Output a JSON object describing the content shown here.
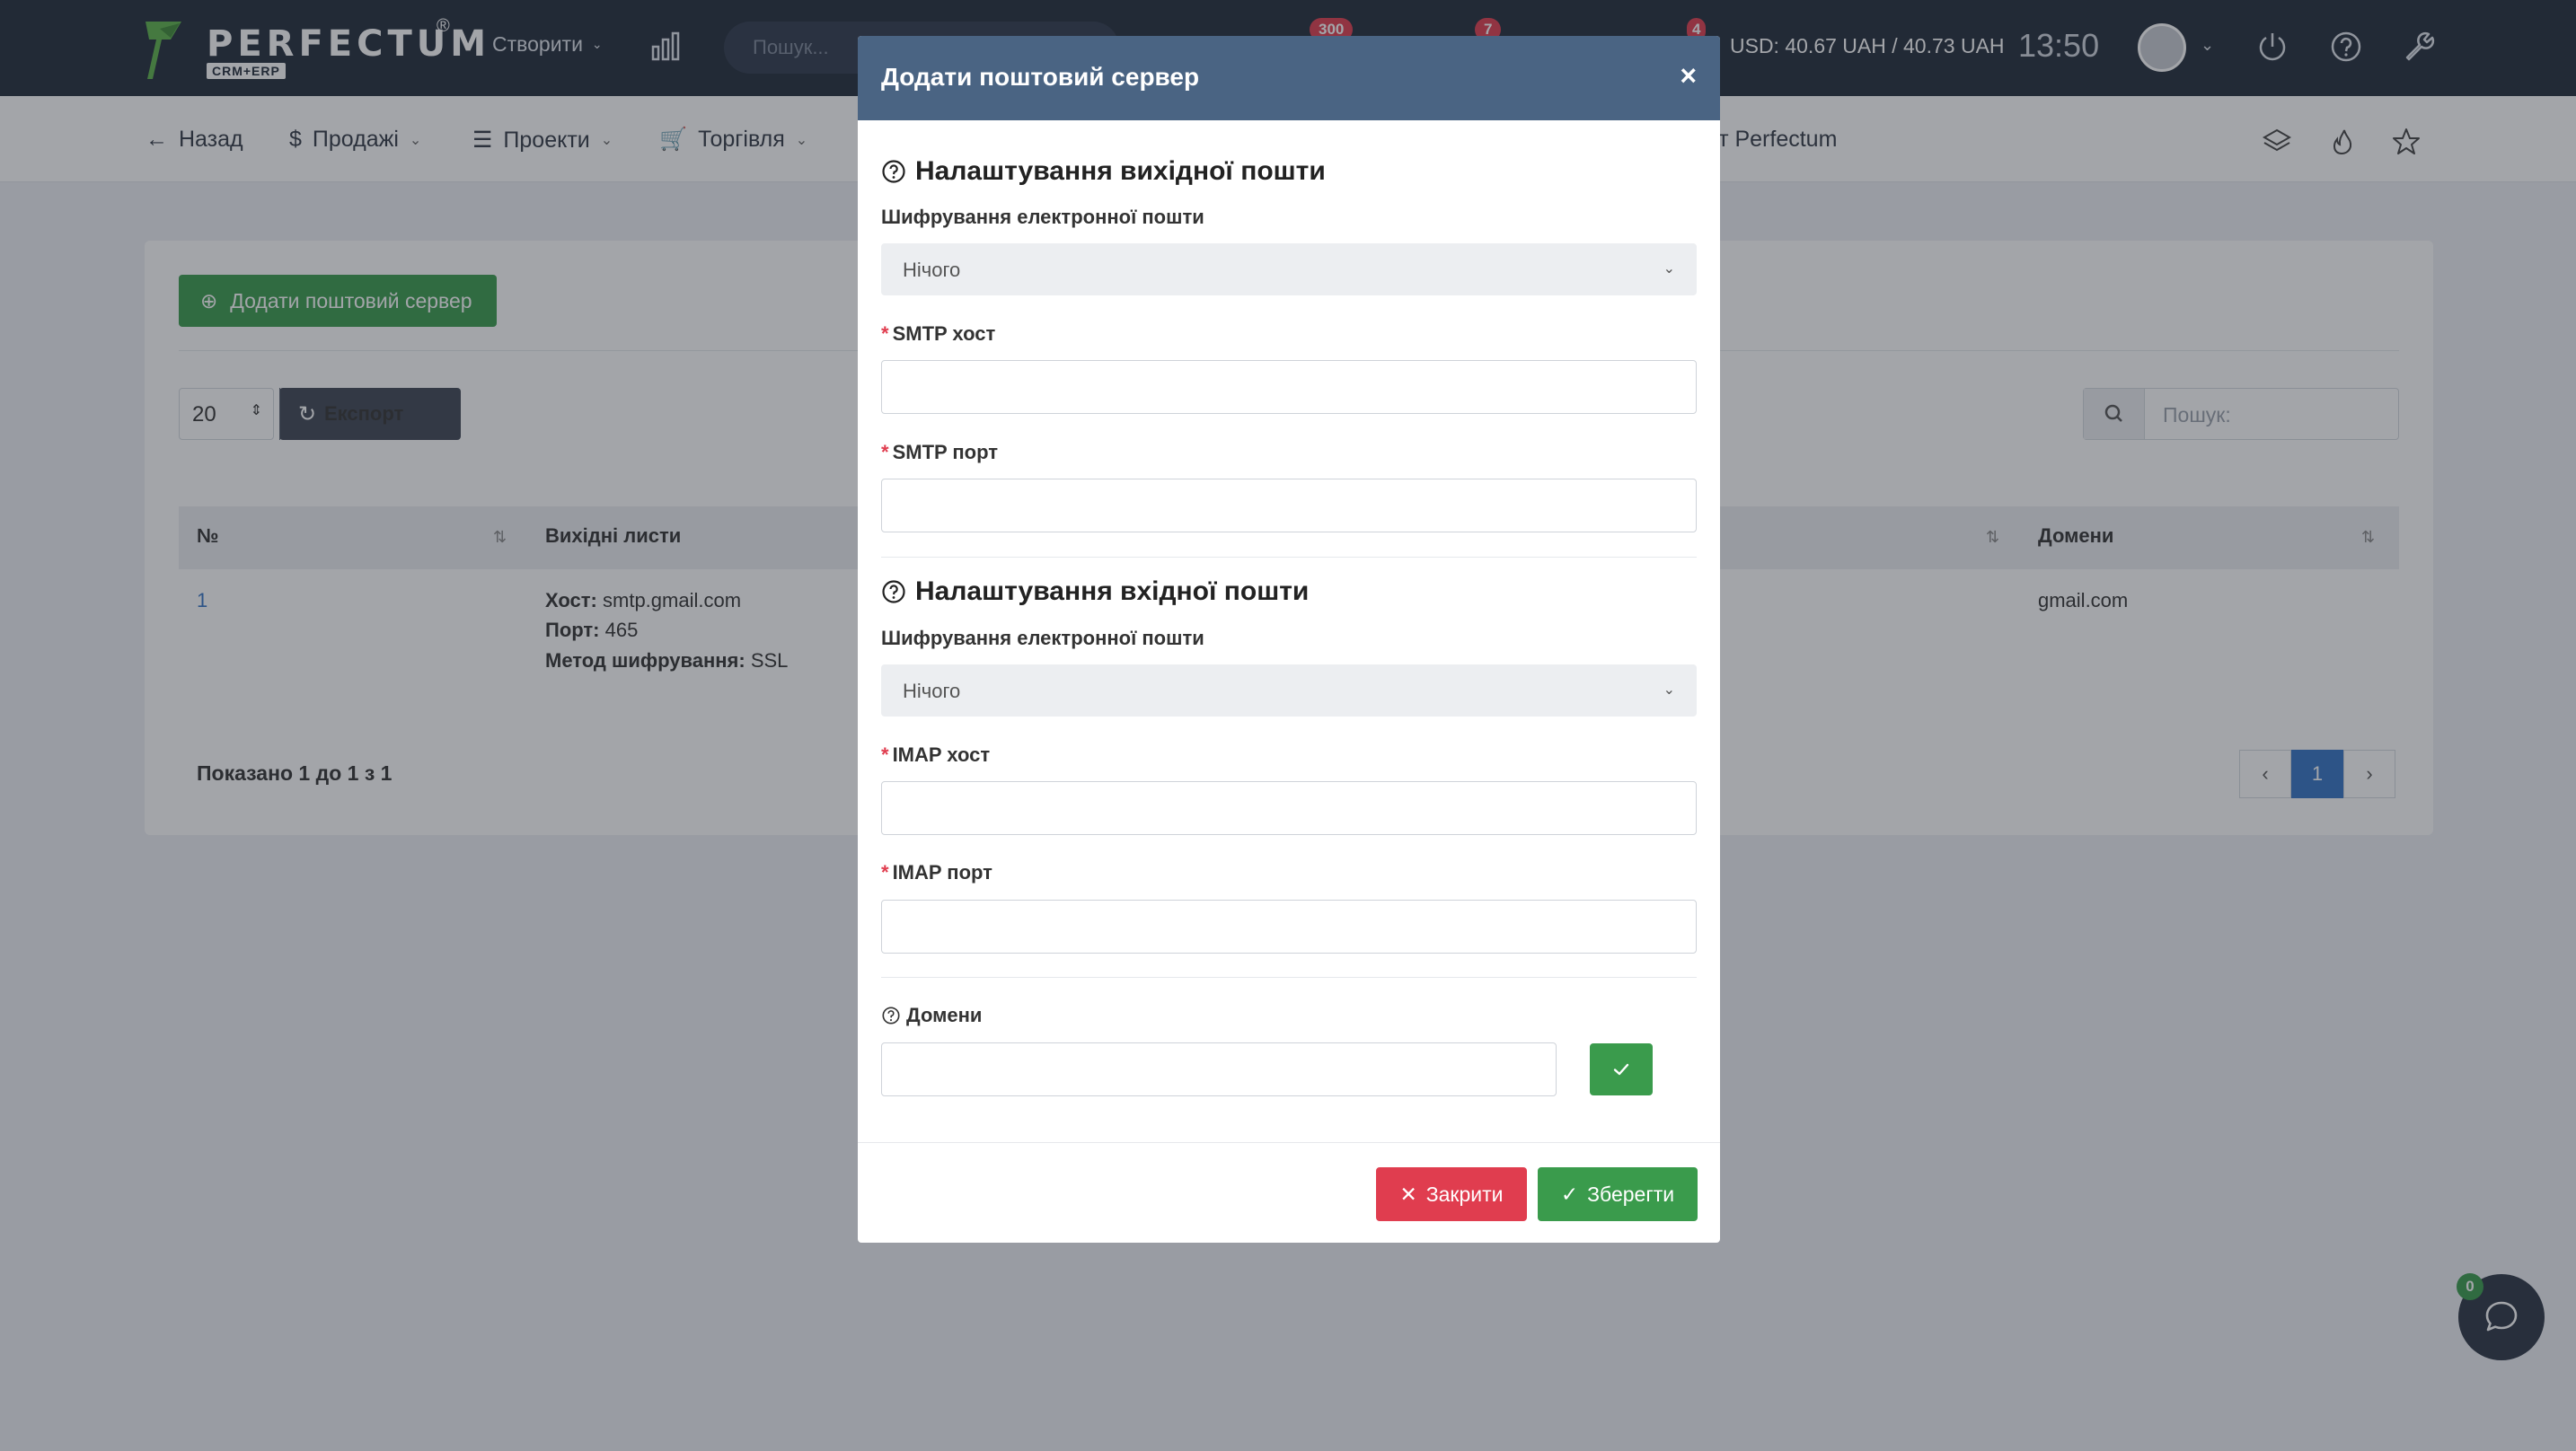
{
  "topbar": {
    "logo_word": "PERFECTUM",
    "logo_reg": "®",
    "logo_sub": "CRM+ERP",
    "create_label": "Створити",
    "search_placeholder": "Пошук...",
    "badges": [
      "300",
      "7",
      "4"
    ],
    "currency": "USD: 40.67 UAH / 40.73 UAH",
    "time": "13:50"
  },
  "subnav": {
    "back": "Назад",
    "sales": "Продажі",
    "projects": "Проекти",
    "trade": "Торгівля",
    "perfectum": "ет Perfectum"
  },
  "card": {
    "add_button": "Додати поштовий сервер",
    "per_page": "20",
    "export_label": "Експорт",
    "search_placeholder": "Пошук:",
    "columns": {
      "no": "№",
      "outgoing": "Вихідні листи",
      "domains": "Домени"
    },
    "row": {
      "no": "1",
      "host_label": "Хост:",
      "host": "smtp.gmail.com",
      "port_label": "Порт:",
      "port": "465",
      "enc_label": "Метод шифрування:",
      "enc": "SSL",
      "domain": "gmail.com"
    },
    "showing": "Показано 1 до 1 з 1",
    "page": "1"
  },
  "modal": {
    "title": "Додати поштовий сервер",
    "close_x": "×",
    "outgoing_title": "Налаштування вихідної пошти",
    "outgoing_enc_label": "Шифрування електронної пошти",
    "outgoing_enc_value": "Нічого",
    "smtp_host_label": "SMTP хост",
    "smtp_port_label": "SMTP порт",
    "incoming_title": "Налаштування вхідної пошти",
    "incoming_enc_label": "Шифрування електронної пошти",
    "incoming_enc_value": "Нічого",
    "imap_host_label": "IMAP хост",
    "imap_port_label": "IMAP порт",
    "domains_label": "Домени",
    "required_mark": "*",
    "close_button": "Закрити",
    "save_button": "Зберегти"
  },
  "chat": {
    "badge": "0"
  },
  "colors": {
    "topbar": "#222b3a",
    "modal_header": "#4a6483",
    "success": "#3a9b4c",
    "danger": "#e03d4f",
    "primary": "#3474c5"
  }
}
